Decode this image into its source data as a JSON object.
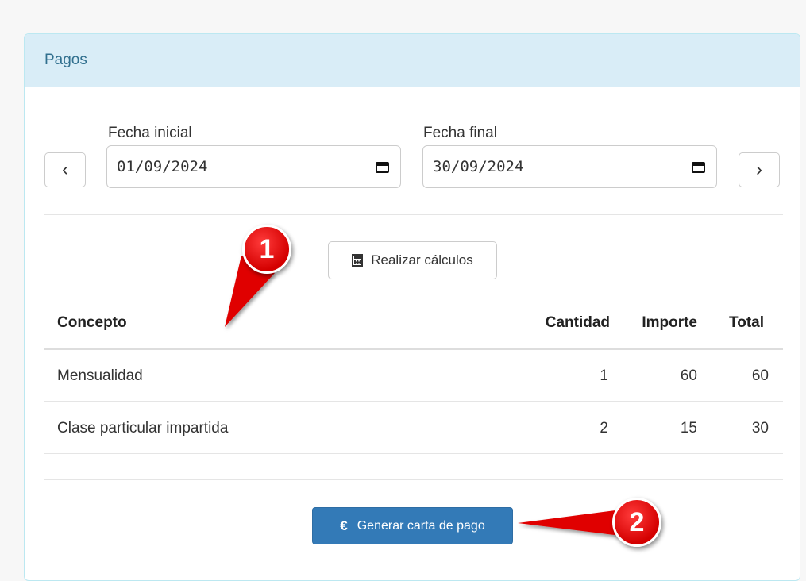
{
  "panel": {
    "title": "Pagos"
  },
  "dates": {
    "start_label": "Fecha inicial",
    "start_value": "01/09/2024",
    "end_label": "Fecha final",
    "end_value": "30/09/2024",
    "prev_symbol": "‹",
    "next_symbol": "›"
  },
  "actions": {
    "calculate_label": "Realizar cálculos",
    "calculate_icon": "calculator-icon",
    "generate_label": "Generar carta de pago",
    "generate_icon_symbol": "€"
  },
  "table": {
    "headers": [
      "Concepto",
      "Cantidad",
      "Importe",
      "Total"
    ],
    "rows": [
      [
        "Mensualidad",
        "1",
        "60",
        "60"
      ],
      [
        "Clase particular impartida",
        "2",
        "15",
        "30"
      ]
    ]
  },
  "annotations": {
    "marker_1": "1",
    "marker_2": "2",
    "color": "#e00000"
  },
  "colors": {
    "panel_heading_bg": "#d9edf7",
    "panel_heading_text": "#31708f",
    "primary": "#337ab7"
  }
}
